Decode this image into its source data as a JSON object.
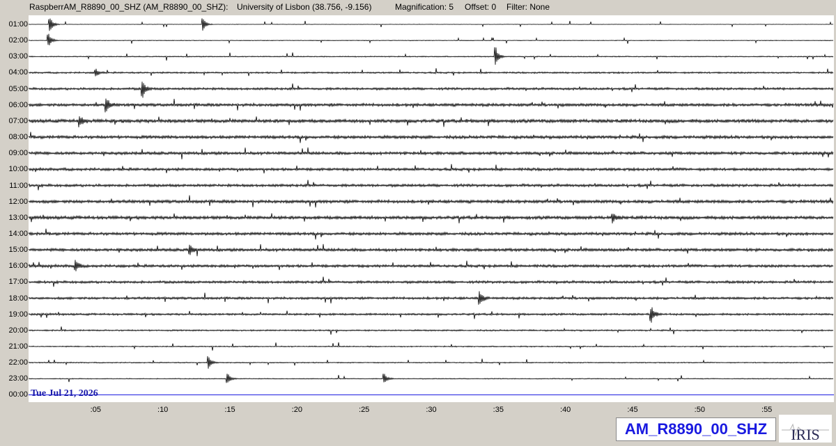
{
  "header": {
    "station_full": "RaspberrAM_R8890_00_SHZ (AM_R8890_00_SHZ):",
    "location": "University of Lisbon (38.756, -9.156)",
    "magnification": "Magnification: 5",
    "offset": "Offset: 0",
    "filter": "Filter: None"
  },
  "date_label": "Tue Jul 21, 2026",
  "station_badge": "AM_R8890_00_SHZ",
  "logo_text": "IRIS",
  "colors": {
    "background": "#d4d0c8",
    "plot_background": "#ffffff",
    "trace": "#000000",
    "current_line": "#1a1ae0",
    "date_label": "#1a1aa8",
    "badge_text": "#1a1ae0"
  },
  "chart_data": {
    "type": "helicorder",
    "row_labels": [
      "01:00",
      "02:00",
      "03:00",
      "04:00",
      "05:00",
      "06:00",
      "07:00",
      "08:00",
      "09:00",
      "10:00",
      "11:00",
      "12:00",
      "13:00",
      "14:00",
      "15:00",
      "16:00",
      "17:00",
      "18:00",
      "19:00",
      "20:00",
      "21:00",
      "22:00",
      "23:00",
      "00:00"
    ],
    "x_tick_labels": [
      ":05",
      ":10",
      ":15",
      ":20",
      ":25",
      ":30",
      ":35",
      ":40",
      ":45",
      ":50",
      ":55"
    ],
    "x_tick_minutes": [
      5,
      10,
      15,
      20,
      25,
      30,
      35,
      40,
      45,
      50,
      55
    ],
    "x_range_minutes": [
      0,
      60
    ],
    "noise_level": [
      0.25,
      0.35,
      0.55,
      0.9,
      1.3,
      1.6,
      1.9,
      1.7,
      1.6,
      1.5,
      1.5,
      1.7,
      1.8,
      1.6,
      1.6,
      1.5,
      1.4,
      1.3,
      1.1,
      0.8,
      0.6,
      0.55,
      0.45,
      0.0
    ],
    "events": [
      {
        "row": 0,
        "minute": 1.6,
        "amplitude": 12
      },
      {
        "row": 0,
        "minute": 13.0,
        "amplitude": 10
      },
      {
        "row": 1,
        "minute": 1.5,
        "amplitude": 10
      },
      {
        "row": 2,
        "minute": 34.8,
        "amplitude": 14
      },
      {
        "row": 3,
        "minute": 5.0,
        "amplitude": 6
      },
      {
        "row": 4,
        "minute": 8.5,
        "amplitude": 12
      },
      {
        "row": 5,
        "minute": 5.8,
        "amplitude": 10
      },
      {
        "row": 6,
        "minute": 3.8,
        "amplitude": 8
      },
      {
        "row": 12,
        "minute": 43.5,
        "amplitude": 7
      },
      {
        "row": 14,
        "minute": 12.0,
        "amplitude": 8
      },
      {
        "row": 15,
        "minute": 3.5,
        "amplitude": 8
      },
      {
        "row": 17,
        "minute": 33.6,
        "amplitude": 11
      },
      {
        "row": 18,
        "minute": 46.4,
        "amplitude": 12
      },
      {
        "row": 21,
        "minute": 13.4,
        "amplitude": 9
      },
      {
        "row": 22,
        "minute": 14.8,
        "amplitude": 9
      },
      {
        "row": 22,
        "minute": 26.5,
        "amplitude": 8
      }
    ],
    "current_row": 23
  }
}
